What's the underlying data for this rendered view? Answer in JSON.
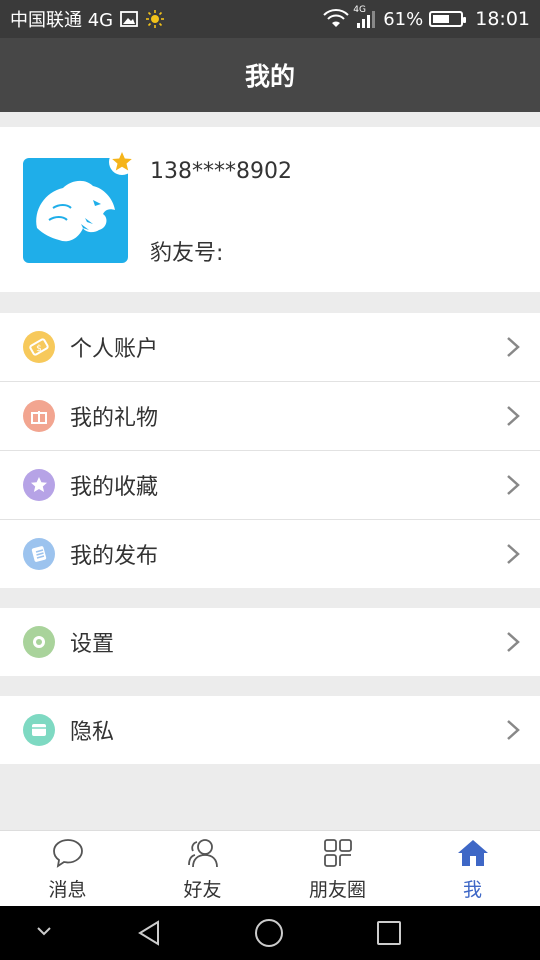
{
  "status_bar": {
    "carrier": "中国联通 4G",
    "battery_percent": "61%",
    "battery_level": 0.61,
    "time": "18:01",
    "network_small": "4G",
    "icons": [
      "image-icon",
      "sun-icon",
      "wifi-icon",
      "signal-icon",
      "battery-icon"
    ]
  },
  "header": {
    "title": "我的"
  },
  "profile": {
    "phone": "138****8902",
    "id_label": "豹友号:",
    "avatar_icon": "panther-avatar-icon",
    "badge_icon": "star-icon"
  },
  "menu": {
    "group1": [
      {
        "label": "个人账户",
        "icon": "wallet-icon",
        "color": "#f7c95b"
      },
      {
        "label": "我的礼物",
        "icon": "gift-icon",
        "color": "#f2a590"
      },
      {
        "label": "我的收藏",
        "icon": "star-icon",
        "color": "#b6a3e6"
      },
      {
        "label": "我的发布",
        "icon": "document-icon",
        "color": "#9cc3ee"
      }
    ],
    "group2": [
      {
        "label": "设置",
        "icon": "settings-icon",
        "color": "#a9d39b"
      }
    ],
    "group3": [
      {
        "label": "隐私",
        "icon": "privacy-icon",
        "color": "#7ed9c2"
      }
    ]
  },
  "tabs": [
    {
      "label": "消息",
      "icon": "chat-icon",
      "active": false
    },
    {
      "label": "好友",
      "icon": "friends-icon",
      "active": false
    },
    {
      "label": "朋友圈",
      "icon": "grid-icon",
      "active": false
    },
    {
      "label": "我",
      "icon": "home-icon",
      "active": true
    }
  ],
  "colors": {
    "accent": "#3e67c6",
    "header_bg": "#474747",
    "status_bg": "#3a3a3a",
    "avatar_bg": "#1faee9"
  },
  "nav_bar": {
    "icons": [
      "chevron-down-icon",
      "back-icon",
      "home-circle-icon",
      "recents-icon"
    ]
  }
}
